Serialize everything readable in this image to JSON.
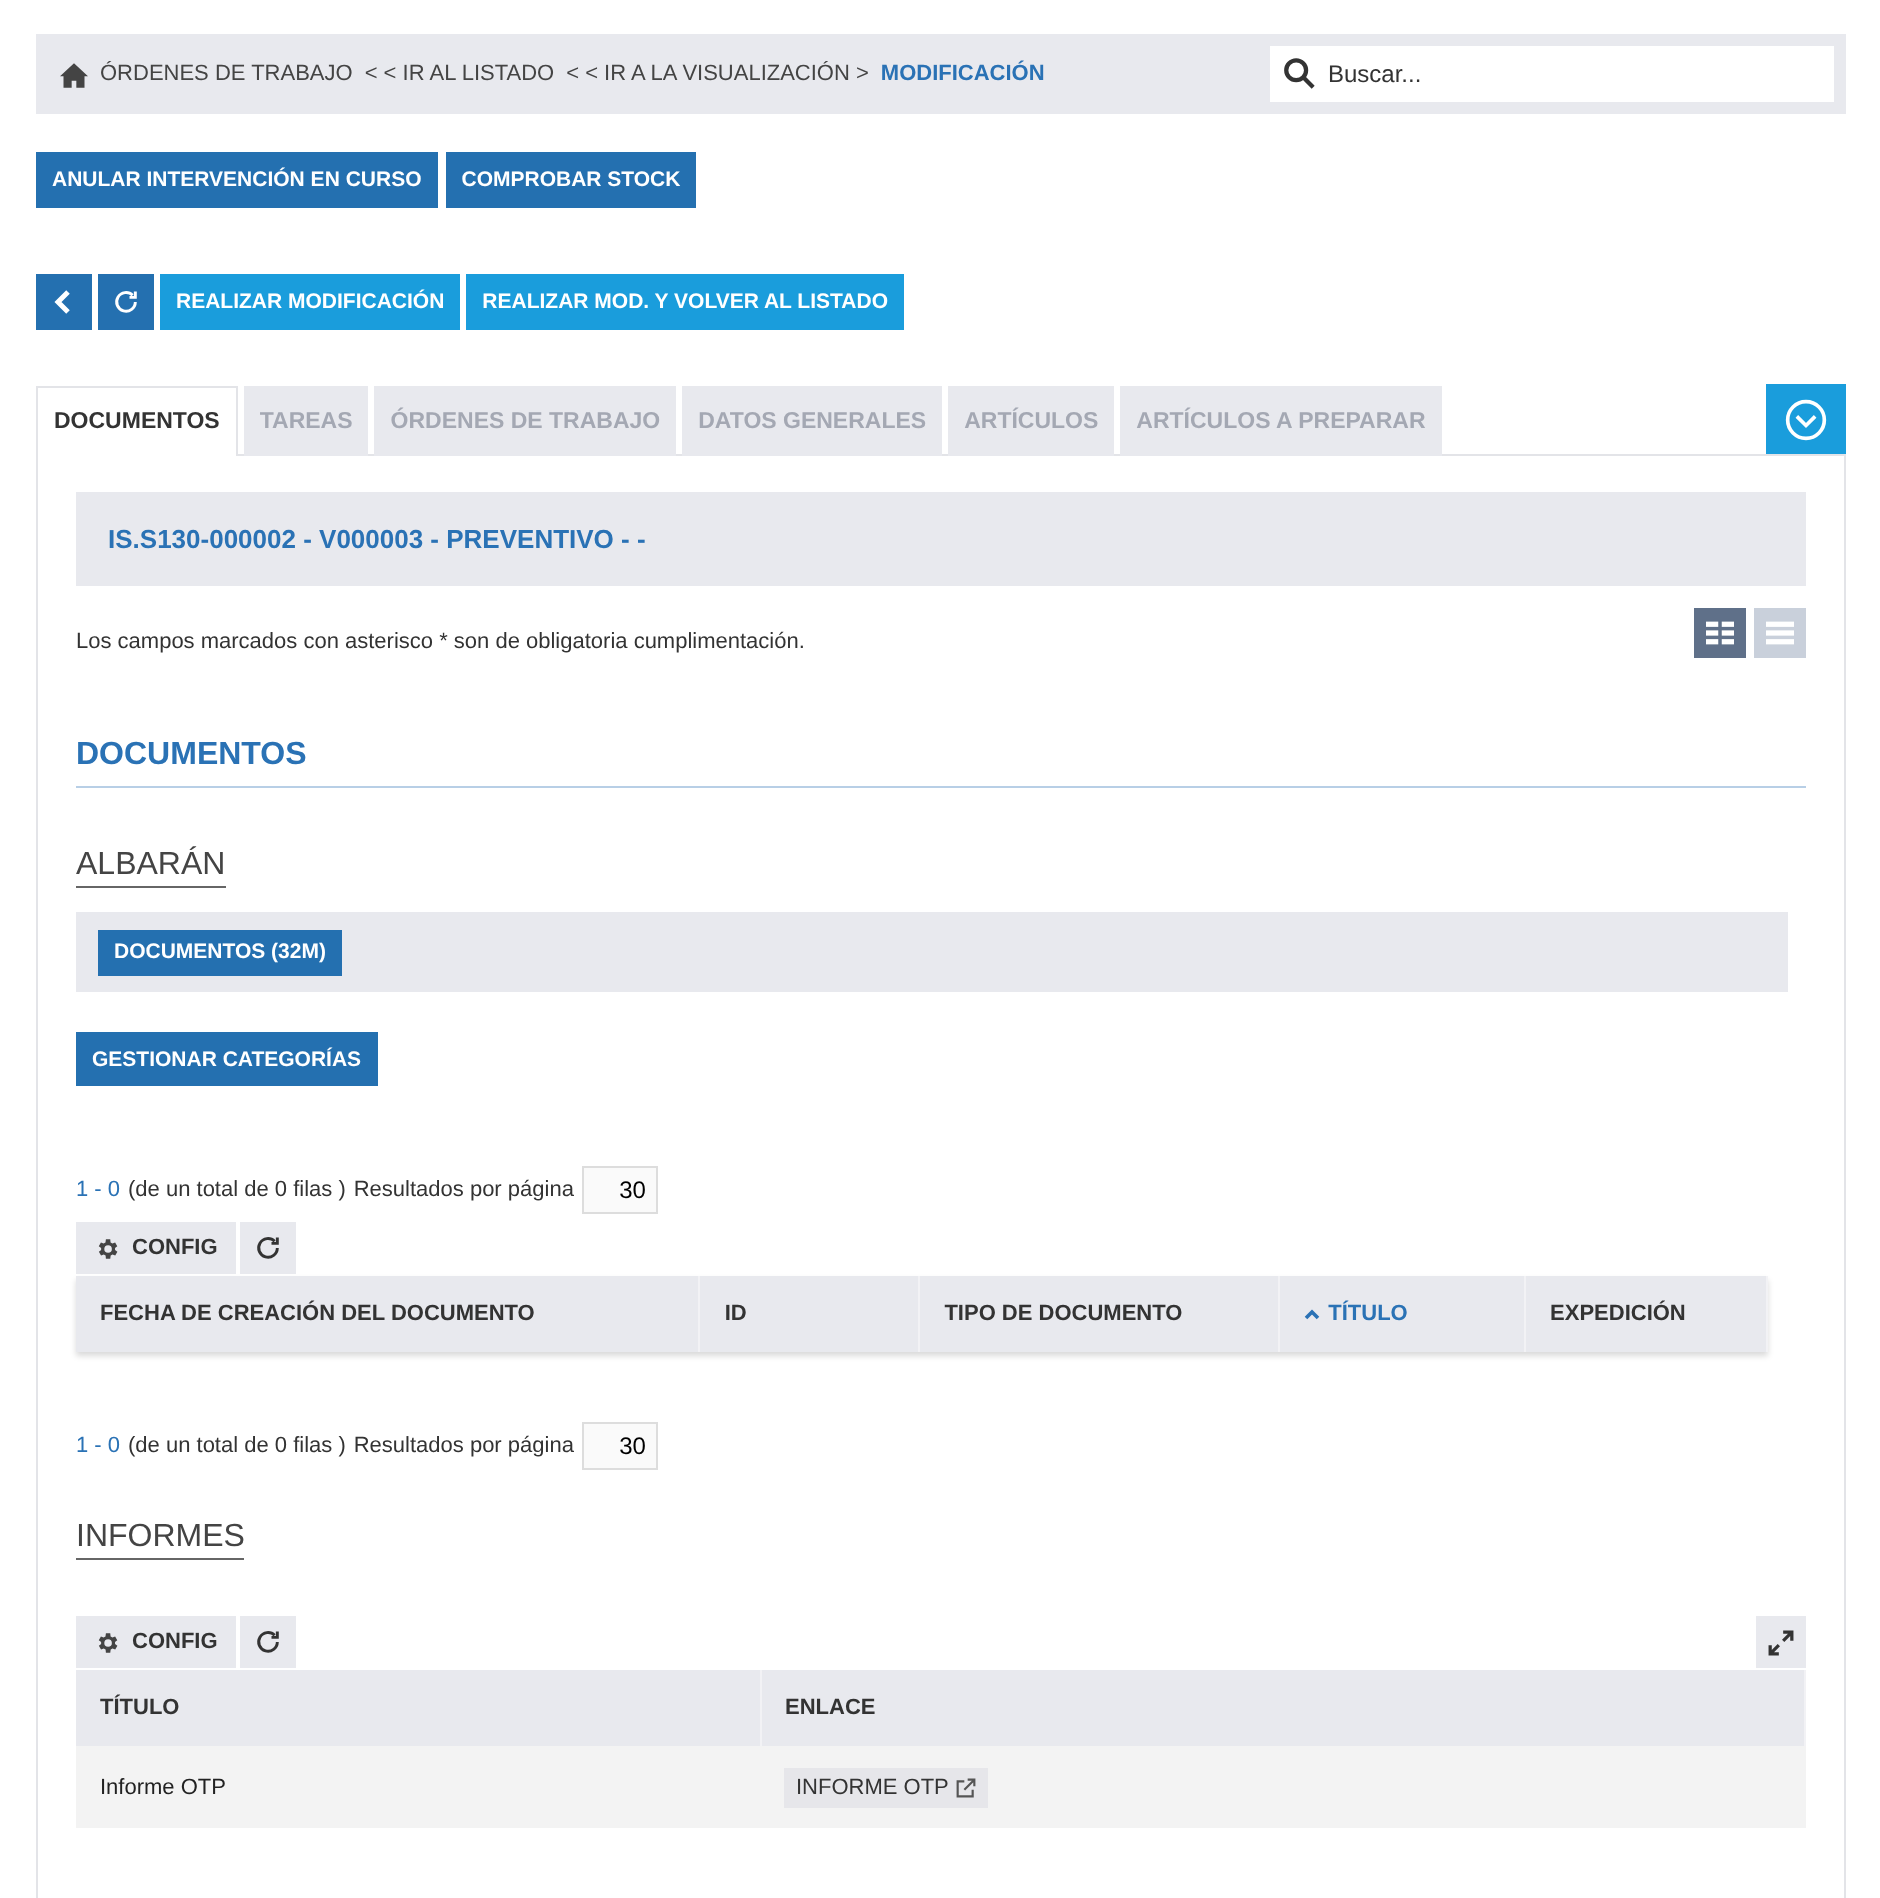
{
  "breadcrumb": [
    {
      "label": "ÓRDENES DE TRABAJO",
      "current": false
    },
    {
      "label": "< < IR AL LISTADO",
      "current": false
    },
    {
      "label": "< < IR A LA VISUALIZACIÓN  >",
      "current": false
    },
    {
      "label": "MODIFICACIÓN",
      "current": true
    }
  ],
  "search": {
    "placeholder": "Buscar..."
  },
  "top_actions": [
    "ANULAR INTERVENCIÓN EN CURSO",
    "COMPROBAR STOCK"
  ],
  "form_actions": [
    "REALIZAR MODIFICACIÓN",
    "REALIZAR MOD. Y VOLVER AL LISTADO"
  ],
  "tabs": [
    {
      "label": "DOCUMENTOS",
      "selected": true
    },
    {
      "label": "TAREAS",
      "selected": false
    },
    {
      "label": "ÓRDENES DE TRABAJO",
      "selected": false
    },
    {
      "label": "DATOS GENERALES",
      "selected": false
    },
    {
      "label": "ARTÍCULOS",
      "selected": false
    },
    {
      "label": "ARTÍCULOS A PREPARAR",
      "selected": false
    }
  ],
  "record_title": "IS.S130-000002 - V000003 - PREVENTIVO - -",
  "note": "Los campos marcados con asterisco * son de obligatoria cumplimentación.",
  "view_modes": [
    {
      "kind": "grid",
      "selected": true
    },
    {
      "kind": "list",
      "selected": false
    }
  ],
  "section_title": "DOCUMENTOS",
  "albaran": {
    "title": "ALBARÁN",
    "chip": "DOCUMENTOS (32M)",
    "manage_button": "GESTIONAR CATEGORÍAS",
    "pagination_top": {
      "range": "1 - 0",
      "summary": "(de un total de 0 filas )",
      "per_page_label": "Resultados por página",
      "per_page": "30"
    },
    "config": "CONFIG",
    "columns": [
      {
        "label": "FECHA DE CREACIÓN DEL DOCUMENTO",
        "sorted": false
      },
      {
        "label": "ID",
        "sorted": false
      },
      {
        "label": "TIPO DE DOCUMENTO",
        "sorted": false
      },
      {
        "label": "TÍTULO",
        "sorted": true
      },
      {
        "label": "EXPEDICIÓN",
        "sorted": false
      }
    ],
    "pagination_bottom": {
      "range": "1 - 0",
      "summary": "(de un total de 0 filas )",
      "per_page_label": "Resultados por página",
      "per_page": "30"
    }
  },
  "informes": {
    "title": "INFORMES",
    "config": "CONFIG",
    "columns": [
      "TÍTULO",
      "ENLACE"
    ],
    "rows": [
      {
        "title": "Informe OTP",
        "link": "INFORME OTP"
      }
    ]
  }
}
